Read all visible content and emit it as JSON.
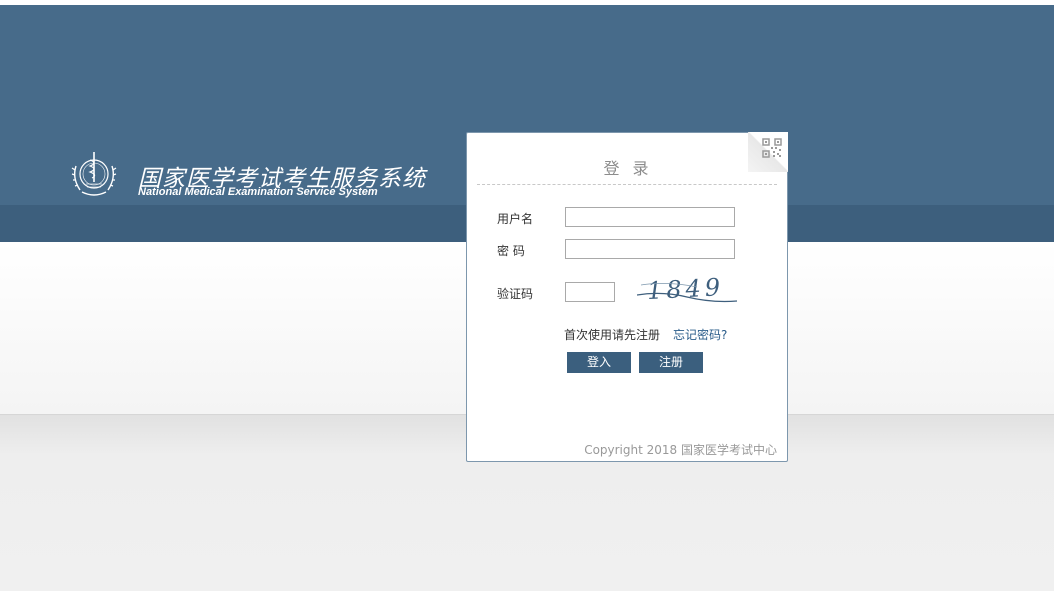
{
  "brand": {
    "title_cn": "国家医学考试考生服务系统",
    "title_en": "National Medical Examination Service System"
  },
  "login": {
    "title": "登 录",
    "username_label": "用户名",
    "password_label": "密 码",
    "captcha_label": "验证码",
    "username_value": "",
    "password_value": "",
    "captcha_value": "",
    "captcha_text": "1849",
    "first_use_hint": "首次使用请先注册",
    "forgot_password_link": "忘记密码?",
    "login_button": "登入",
    "register_button": "注册",
    "copyright": "Copyright 2018 国家医学考试中心"
  },
  "colors": {
    "header": "#476b8a",
    "header_dark": "#3d5f7d",
    "button": "#3b5f7e",
    "link": "#2a5c8a"
  },
  "icons": {
    "logo": "medical-emblem-icon",
    "corner": "qr-code-icon"
  }
}
